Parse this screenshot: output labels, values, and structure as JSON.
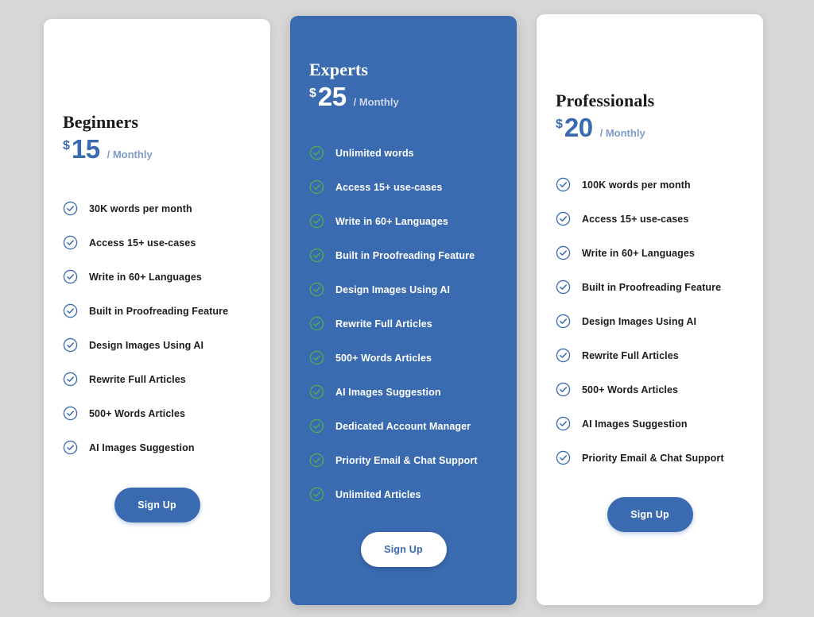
{
  "page": {
    "background_color": "#d7d7d7"
  },
  "colors": {
    "brand_blue": "#3a6ab0",
    "check_blue": "#3a6ab0",
    "check_green": "#4caf50",
    "card_white": "#ffffff",
    "text_dark": "#1c1c1c",
    "text_light": "#ffffff",
    "period_muted_blue": "#7e9bc9",
    "period_muted_light": "#cdd6e6"
  },
  "plans": [
    {
      "id": "beginners",
      "name": "Beginners",
      "currency": "$",
      "amount": "15",
      "period": "/ Monthly",
      "featured": false,
      "check_icon": "check-circle-icon",
      "check_color": "#3a6ab0",
      "features": [
        "30K words per month",
        "Access 15+ use-cases",
        "Write in 60+ Languages",
        "Built in Proofreading Feature",
        "Design Images Using AI",
        "Rewrite Full Articles",
        "500+ Words Articles",
        "AI Images Suggestion"
      ],
      "cta_label": "Sign Up"
    },
    {
      "id": "experts",
      "name": "Experts",
      "currency": "$",
      "amount": "25",
      "period": "/ Monthly",
      "featured": true,
      "check_icon": "check-circle-icon",
      "check_color": "#4caf50",
      "features": [
        "Unlimited words",
        "Access 15+ use-cases",
        "Write in 60+ Languages",
        "Built in Proofreading Feature",
        "Design Images Using AI",
        "Rewrite Full Articles",
        "500+ Words Articles",
        "AI Images Suggestion",
        "Dedicated Account Manager",
        "Priority Email & Chat Support",
        "Unlimited Articles"
      ],
      "cta_label": "Sign Up"
    },
    {
      "id": "professionals",
      "name": "Professionals",
      "currency": "$",
      "amount": "20",
      "period": "/ Monthly",
      "featured": false,
      "check_icon": "check-circle-icon",
      "check_color": "#3a6ab0",
      "features": [
        "100K words per month",
        "Access 15+ use-cases",
        "Write in 60+ Languages",
        "Built in Proofreading Feature",
        "Design Images Using AI",
        "Rewrite Full Articles",
        "500+ Words Articles",
        "AI Images Suggestion",
        "Priority Email & Chat Support"
      ],
      "cta_label": "Sign Up"
    }
  ]
}
